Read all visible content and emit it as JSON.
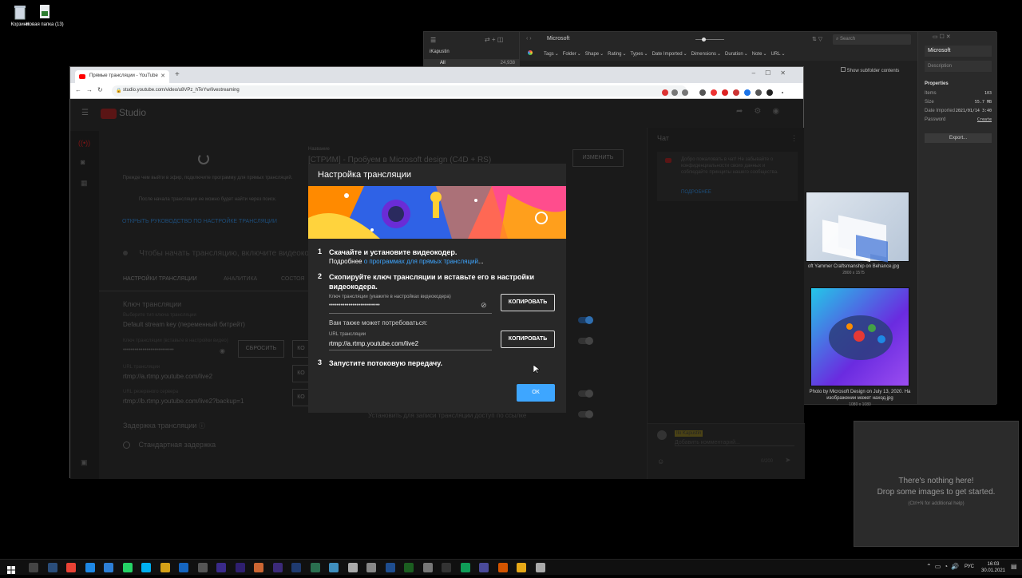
{
  "desktop": {
    "icons": [
      {
        "label": "Корзина"
      },
      {
        "label": "Новая папка (13)"
      }
    ]
  },
  "eagle": {
    "library": "iKapustin",
    "all_label": "All",
    "all_count": "24,938",
    "search_folder": "Microsoft",
    "search_placeholder": "Search",
    "filters": [
      "Tags",
      "Folder",
      "Shape",
      "Rating",
      "Types",
      "Date Imported",
      "Dimensions",
      "Duration",
      "Note",
      "URL"
    ],
    "show_subfolder": "Show subfolder contents",
    "panel": {
      "name": "Microsoft",
      "description_placeholder": "Description",
      "properties_title": "Properties",
      "props": [
        {
          "k": "Items",
          "v": "103"
        },
        {
          "k": "Size",
          "v": "55.7 MB"
        },
        {
          "k": "Date Imported",
          "v": "2021/01/14 3:40"
        },
        {
          "k": "Password",
          "v": "Create"
        }
      ],
      "export_label": "Export..."
    },
    "thumbs": [
      {
        "caption": "oft Yammer Craftsmanship on Behance.jpg",
        "dims": "2800 x 1575"
      },
      {
        "caption": "Photo by Microsoft Design on July 13, 2020. На изображении может наход.jpg",
        "dims": "1080 x 1080"
      }
    ],
    "drop": {
      "line1": "There's nothing here!",
      "line2": "Drop some images to get started.",
      "hint": "(Ctrl+N for additional help)"
    }
  },
  "chrome": {
    "tab_title": "Прямые трансляции - YouTube",
    "url": "studio.youtube.com/video/u8VPz_hTeYw/livestreaming"
  },
  "studio": {
    "logo": "Studio",
    "prep_text": "Прежде чем выйти в эфир, подключите программу для прямых трансляций.",
    "delay_text": "После начала трансляции ее можно будет найти через поиск.",
    "guide_link": "ОТКРЫТЬ РУКОВОДСТВО ПО НАСТРОЙКЕ ТРАНСЛЯЦИИ",
    "name_label": "Название",
    "stream_title": "[СТРИМ] - Пробуем в Microsoft design (C4D + RS)",
    "edit_btn": "ИЗМЕНИТЬ",
    "enable_encoder": "Чтобы начать трансляцию, включите видеокодер.",
    "tabs": [
      "НАСТРОЙКИ ТРАНСЛЯЦИИ",
      "АНАЛИТИКА",
      "СОСТОЯ"
    ],
    "key_section": "Ключ трансляции",
    "key_select_label": "Выберите тип ключа трансляции",
    "key_select_value": "Default stream key (переменный битрейт)",
    "key_label": "Ключ трансляции (вставьте в настройки видео)",
    "key_value": "••••••••••••••••••••••••••",
    "reset_btn": "СБРОСИТЬ",
    "url_label": "URL трансляции",
    "url_value": "rtmp://a.rtmp.youtube.com/live2",
    "backup_label": "URL резервного сервера",
    "backup_value": "rtmp://b.rtmp.youtube.com/live2?backup=1",
    "copy_short": "КО",
    "delay_section": "Задержка трансляции",
    "delay_option": "Стандартная задержка",
    "record_text": "Установить для записи трансляции доступ по ссылке",
    "chat": {
      "title": "Чат",
      "welcome": "Добро пожаловать в чат! Не забывайте о конфиденциальности своих данных и соблюдайте принципы нашего сообщества.",
      "more": "ПОДРОБНЕЕ",
      "user": "Ilo Kapustin",
      "placeholder": "Добавить комментарий...",
      "counter": "0/200"
    }
  },
  "modal": {
    "title": "Настройка трансляции",
    "step1_num": "1",
    "step1": "Скачайте и установите видеокодер.",
    "step1_sub_prefix": "Подробнее ",
    "step1_link": "о программах для прямых трансляций",
    "step1_suffix": "...",
    "step2_num": "2",
    "step2": "Скопируйте ключ трансляции и вставьте его в настройки видеокодера.",
    "key_label": "Ключ трансляции (укажите в настройках видеокодера)",
    "key_value": "••••••••••••••••••••••••••",
    "copy1": "КОПИРОВАТЬ",
    "also_need": "Вам также может потребоваться:",
    "url_label": "URL трансляции",
    "url_value": "rtmp://a.rtmp.youtube.com/live2",
    "copy2": "КОПИРОВАТЬ",
    "step3_num": "3",
    "step3": "Запустите потоковую передачу.",
    "ok": "ОК"
  },
  "taskbar": {
    "lang": "РУС",
    "time": "16:03",
    "date": "30.01.2021"
  },
  "colors": {
    "accent": "#3ea6ff",
    "yt_red": "#ff0000",
    "banner": "#2f62e6"
  }
}
